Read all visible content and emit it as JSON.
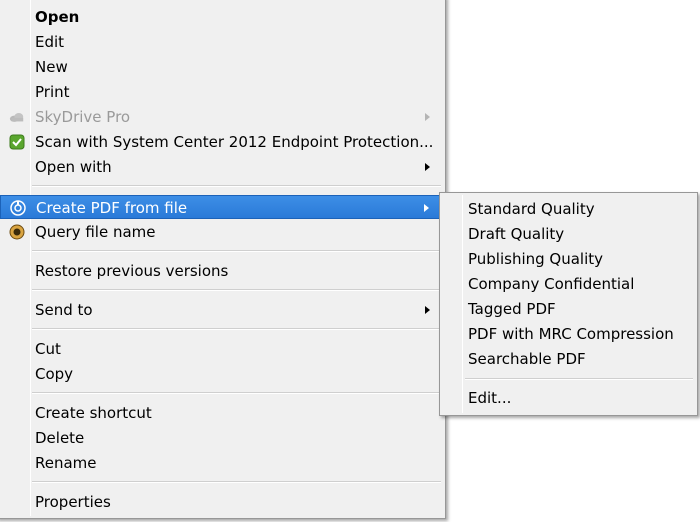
{
  "context_menu": {
    "items": [
      {
        "label": "Open"
      },
      {
        "label": "Edit"
      },
      {
        "label": "New"
      },
      {
        "label": "Print"
      },
      {
        "label": "SkyDrive Pro",
        "icon": "cloud-icon"
      },
      {
        "label": "Scan with System Center 2012 Endpoint Protection...",
        "icon": "shield-check-icon"
      },
      {
        "label": "Open with"
      },
      {
        "label": "Create PDF from file",
        "icon": "pdf-icon"
      },
      {
        "label": "Query file name",
        "icon": "query-icon"
      },
      {
        "label": "Restore previous versions"
      },
      {
        "label": "Send to"
      },
      {
        "label": "Cut"
      },
      {
        "label": "Copy"
      },
      {
        "label": "Create shortcut"
      },
      {
        "label": "Delete"
      },
      {
        "label": "Rename"
      },
      {
        "label": "Properties"
      }
    ]
  },
  "submenu": {
    "items": [
      {
        "label": "Standard Quality"
      },
      {
        "label": "Draft Quality"
      },
      {
        "label": "Publishing Quality"
      },
      {
        "label": "Company Confidential"
      },
      {
        "label": "Tagged PDF"
      },
      {
        "label": "PDF with MRC Compression"
      },
      {
        "label": "Searchable PDF"
      },
      {
        "label": "Edit..."
      }
    ]
  },
  "colors": {
    "menu_background": "#f0f0f0",
    "highlight": "#2a7ad8",
    "disabled_text": "#9a9a9a"
  }
}
